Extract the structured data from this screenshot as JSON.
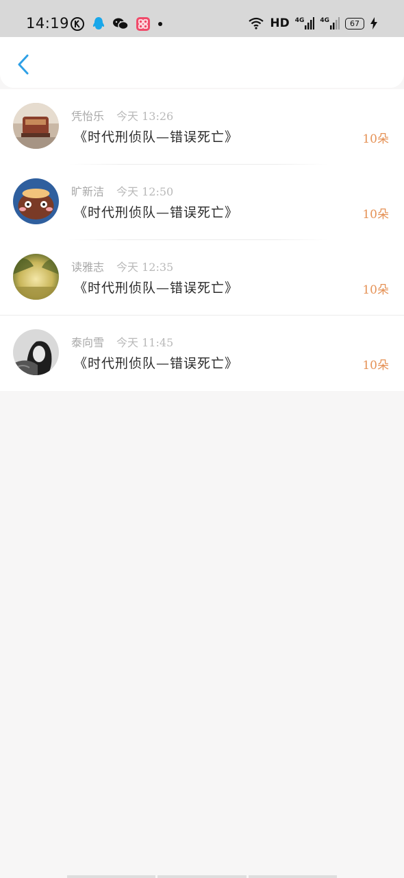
{
  "status_bar": {
    "time": "14:19",
    "network_label": "HD",
    "signal_1": "4G",
    "signal_2": "4G",
    "battery": "67"
  },
  "header": {
    "back_icon": "chevron-left-icon"
  },
  "colors": {
    "accent": "#2ea0e6",
    "count": "#e59155"
  },
  "items": [
    {
      "name": "凭怡乐",
      "time": "今天 13:26",
      "title": "《时代刑侦队—错误死亡》",
      "count": "10朵"
    },
    {
      "name": "旷新洁",
      "time": "今天 12:50",
      "title": "《时代刑侦队—错误死亡》",
      "count": "10朵"
    },
    {
      "name": "读雅志",
      "time": "今天 12:35",
      "title": "《时代刑侦队—错误死亡》",
      "count": "10朵"
    },
    {
      "name": "泰向雪",
      "time": "今天 11:45",
      "title": "《时代刑侦队—错误死亡》",
      "count": "10朵"
    }
  ]
}
